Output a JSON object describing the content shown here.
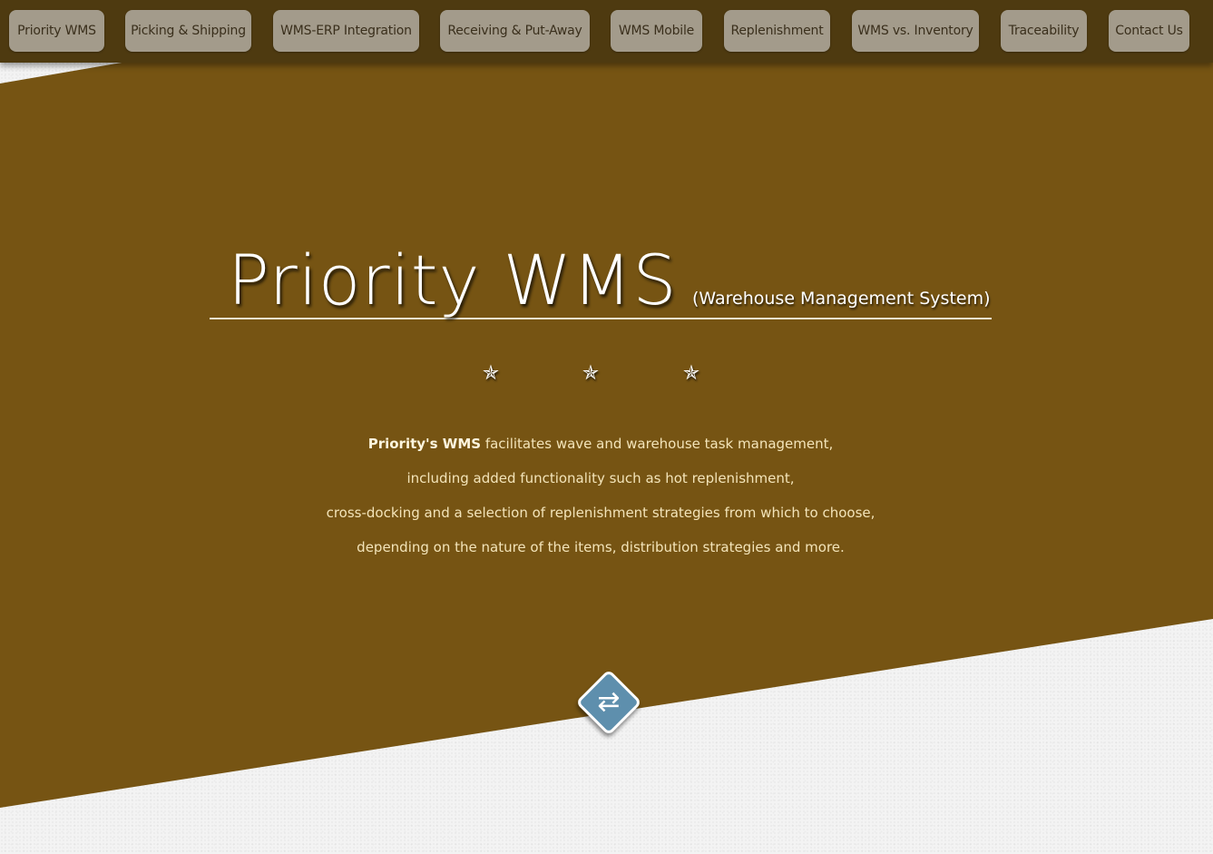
{
  "nav": {
    "items": [
      {
        "label": "Priority WMS"
      },
      {
        "label": "Picking & Shipping"
      },
      {
        "label": "WMS-ERP Integration"
      },
      {
        "label": "Receiving & Put-Away"
      },
      {
        "label": "WMS Mobile"
      },
      {
        "label": "Replenishment"
      },
      {
        "label": "WMS vs. Inventory"
      },
      {
        "label": "Traceability"
      },
      {
        "label": "Contact Us"
      }
    ]
  },
  "hero": {
    "title": "Priority WMS",
    "subtitle": "(Warehouse Management System)",
    "star_glyph": "✯",
    "description": {
      "lead_bold": "Priority's WMS",
      "line1_rest": " facilitates wave and warehouse task management,",
      "line2": "including added functionality such as hot replenishment,",
      "line3": "cross-docking and a selection of replenishment strategies from which to choose,",
      "line4": "depending on the nature of the items, distribution strategies and more."
    }
  },
  "scroll_button": {
    "icon": "swap-arrows-icon",
    "glyph": "⇄"
  },
  "colors": {
    "navbar": "#4e3a10",
    "nav_button": "#a39b8b",
    "hero_brown": "#765413",
    "accent_blue": "#5e8fad",
    "background": "#f3f3f3"
  }
}
